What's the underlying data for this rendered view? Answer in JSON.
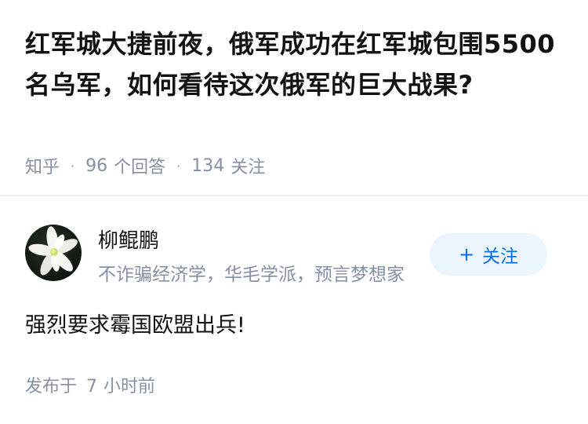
{
  "question": {
    "title": "红军城大捷前夜，俄军成功在红军城包围5500名乌军，如何看待这次俄军的巨大战果?",
    "source": "知乎",
    "answer_count": "96",
    "answer_label": "个回答",
    "follow_count": "134",
    "follow_label": "关注"
  },
  "answer": {
    "author_name": "柳鲲鹏",
    "author_bio": "不诈骗经济学，华毛学派，预言梦想家",
    "follow_button": "关注",
    "content": "强烈要求霉国欧盟出兵!",
    "time_prefix": "发布于",
    "time_value": "7",
    "time_unit": "小时前",
    "avatar_icon": "white-lily-flower-icon"
  },
  "colors": {
    "text": "#121212",
    "muted": "#8590a6",
    "accent": "#056de8",
    "button_bg": "#ebf5ff"
  }
}
